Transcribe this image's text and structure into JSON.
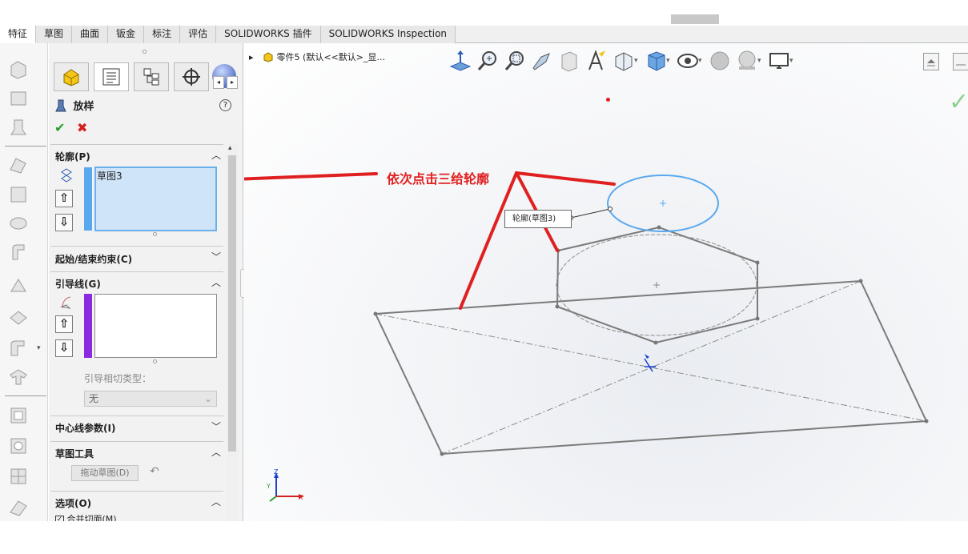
{
  "command_tabs": [
    {
      "label": "特征",
      "active": true
    },
    {
      "label": "草图",
      "active": false
    },
    {
      "label": "曲面",
      "active": false
    },
    {
      "label": "钣金",
      "active": false
    },
    {
      "label": "标注",
      "active": false
    },
    {
      "label": "评估",
      "active": false
    },
    {
      "label": "SOLIDWORKS 插件",
      "active": false
    },
    {
      "label": "SOLIDWORKS Inspection",
      "active": false
    }
  ],
  "property_manager": {
    "title": "放样",
    "help_label": "?",
    "ok_label": "✔",
    "cancel_label": "✖",
    "profiles": {
      "header": "轮廓(P)",
      "items": [
        "草图3"
      ]
    },
    "start_end_constraints": {
      "header": "起始/结束约束(C)"
    },
    "guide_curves": {
      "header": "引导线(G)",
      "tangency_label": "引导相切类型：",
      "tangency_value": "无"
    },
    "centerline": {
      "header": "中心线参数(I)"
    },
    "sketch_tools": {
      "header": "草图工具",
      "drag_button": "拖动草图(D)"
    },
    "options": {
      "header": "选项(O)",
      "merge_tangent": "合并切面(M)"
    }
  },
  "feature_tree": {
    "part_label": "零件5 (默认<<默认>_显..."
  },
  "graphics": {
    "callout_label": "轮廓(草图3)",
    "annotation_text": "依次点击三给轮廓",
    "triad": {
      "x": "X",
      "y": "Y",
      "z": "Z"
    }
  },
  "colors": {
    "annotation_red": "#e02020",
    "selected_profile_blue": "#5aa9ee",
    "guide_purple": "#8a2be2",
    "ok_green": "#2a9d2a"
  }
}
